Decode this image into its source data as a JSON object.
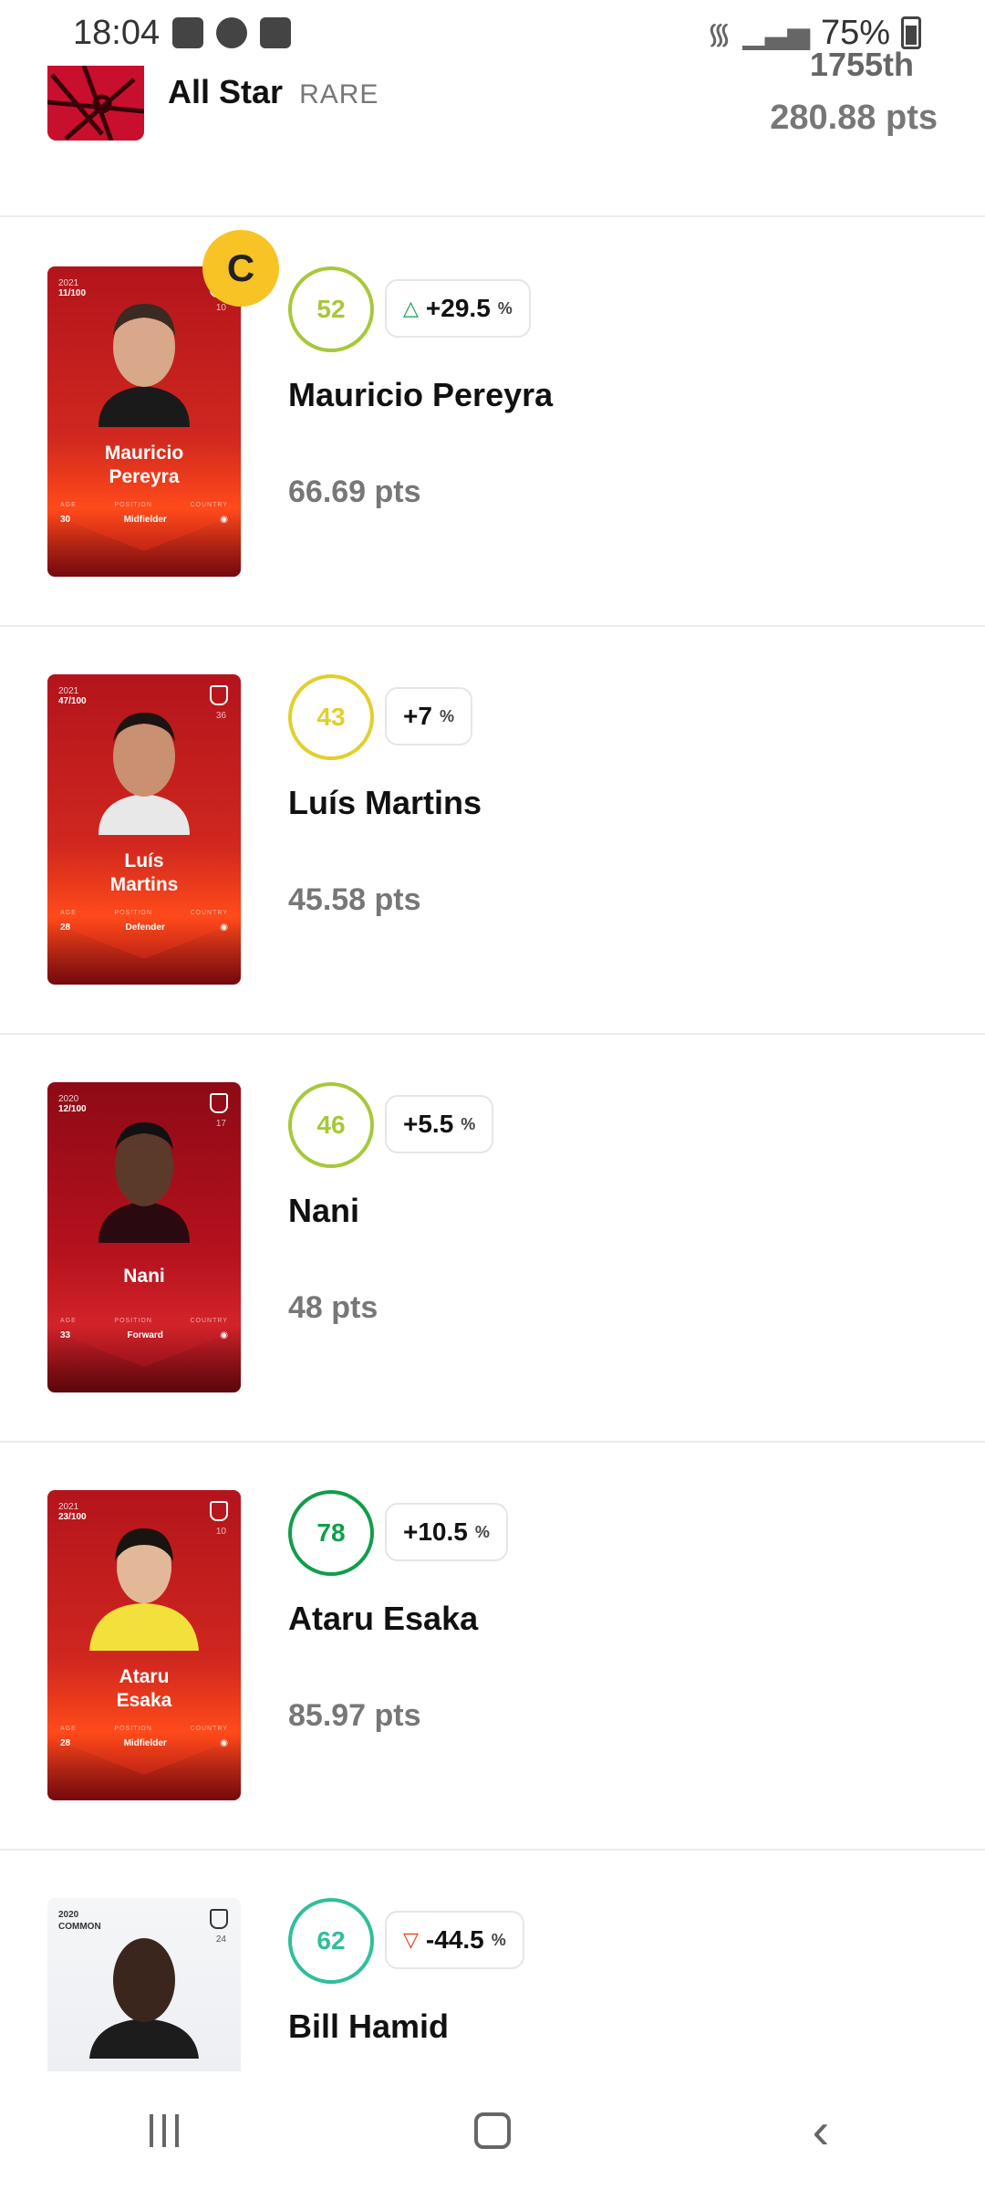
{
  "status_bar": {
    "time": "18:04",
    "battery": "75%"
  },
  "lineup": {
    "name": "All Star",
    "rarity": "RARE",
    "rank": "1755th",
    "score": "280.88 pts"
  },
  "players": [
    {
      "card_season": "2021",
      "card_serial": "11/100",
      "card_num": "10",
      "card_name": "Mauricio\nPereyra",
      "age": "30",
      "position": "Midfielder",
      "captain": "C",
      "score": "52",
      "score_color": "#a6c83a",
      "bonus": "+29.5",
      "bonus_dir": "up",
      "name": "Mauricio Pereyra",
      "pts": "66.69 pts"
    },
    {
      "card_season": "2021",
      "card_serial": "47/100",
      "card_num": "36",
      "card_name": "Luís\nMartins",
      "age": "28",
      "position": "Defender",
      "score": "43",
      "score_color": "#e2cf2b",
      "bonus": "+7",
      "bonus_dir": "none",
      "name": "Luís Martins",
      "pts": "45.58 pts"
    },
    {
      "card_season": "2020",
      "card_serial": "12/100",
      "card_num": "17",
      "card_name": "Nani",
      "age": "33",
      "position": "Forward",
      "score": "46",
      "score_color": "#a6c83a",
      "bonus": "+5.5",
      "bonus_dir": "none",
      "name": "Nani",
      "pts": "48 pts"
    },
    {
      "card_season": "2021",
      "card_serial": "23/100",
      "card_num": "10",
      "card_name": "Ataru\nEsaka",
      "age": "28",
      "position": "Midfielder",
      "score": "78",
      "score_color": "#0f9e4a",
      "bonus": "+10.5",
      "bonus_dir": "none",
      "name": "Ataru Esaka",
      "pts": "85.97 pts"
    },
    {
      "card_season": "2020",
      "card_serial": "COMMON",
      "card_num": "24",
      "score": "62",
      "score_color": "#2fbf9a",
      "bonus": "-44.5",
      "bonus_dir": "down",
      "name": "Bill Hamid"
    }
  ],
  "card_labels": {
    "age": "AGE",
    "position": "POSITION",
    "country": "COUNTRY"
  },
  "icons": {
    "gallery": "gallery-icon",
    "soccer": "soccer-ball-icon",
    "sync": "sync-icon",
    "wifi": "wifi-icon",
    "signal": "signal-icon",
    "battery": "battery-icon"
  }
}
